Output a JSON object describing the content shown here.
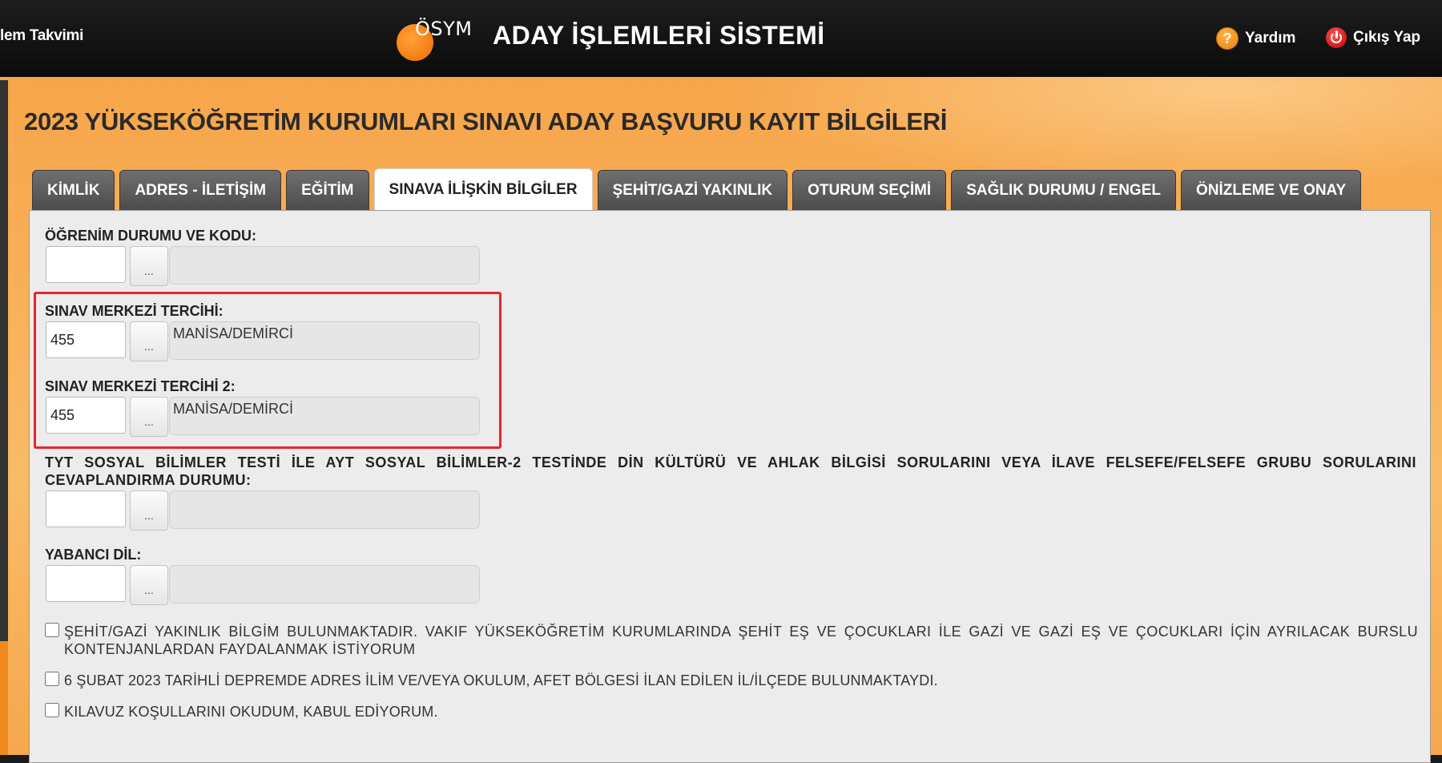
{
  "topbar": {
    "left_link": "lem Takvimi",
    "logo_text": "ÖSYM",
    "system_title": "ADAY İŞLEMLERİ SİSTEMİ",
    "help_label": "Yardım",
    "logout_label": "Çıkış Yap"
  },
  "page": {
    "title": "2023 YÜKSEKÖĞRETİM KURUMLARI SINAVI ADAY BAŞVURU KAYIT BİLGİLERİ"
  },
  "tabs": [
    {
      "label": "KİMLİK"
    },
    {
      "label": "ADRES - İLETİŞİM"
    },
    {
      "label": "EĞİTİM"
    },
    {
      "label": "SINAVA İLİŞKİN BİLGİLER",
      "active": true
    },
    {
      "label": "ŞEHİT/GAZİ YAKINLIK"
    },
    {
      "label": "OTURUM SEÇİMİ"
    },
    {
      "label": "SAĞLIK DURUMU / ENGEL"
    },
    {
      "label": "ÖNİZLEME VE ONAY"
    }
  ],
  "form": {
    "ogrenim": {
      "label": "ÖĞRENİM DURUMU VE KODU:",
      "code": "",
      "dots": "...",
      "desc": ""
    },
    "sinav_merkezi_1": {
      "label": "SINAV MERKEZİ TERCİHİ:",
      "code": "455",
      "dots": "...",
      "desc": "MANİSA/DEMİRCİ"
    },
    "sinav_merkezi_2": {
      "label": "SINAV MERKEZİ TERCİHİ 2:",
      "code": "455",
      "dots": "...",
      "desc": "MANİSA/DEMİRCİ"
    },
    "tyt_sosyal": {
      "label": "TYT SOSYAL BİLİMLER TESTİ İLE AYT SOSYAL BİLİMLER-2 TESTİNDE DİN KÜLTÜRÜ VE AHLAK BİLGİSİ SORULARINI VEYA İLAVE FELSEFE/FELSEFE GRUBU SORULARINI CEVAPLANDIRMA DURUMU:",
      "code": "",
      "dots": "...",
      "desc": ""
    },
    "yabanci_dil": {
      "label": "YABANCI DİL:",
      "code": "",
      "dots": "...",
      "desc": ""
    }
  },
  "checkboxes": [
    {
      "text": "ŞEHİT/GAZİ YAKINLIK BİLGİM BULUNMAKTADIR. VAKIF YÜKSEKÖĞRETİM KURUMLARINDA ŞEHİT EŞ VE ÇOCUKLARI İLE GAZİ VE GAZİ EŞ VE ÇOCUKLARI İÇİN AYRILACAK BURSLU KONTENJANLARDAN FAYDALANMAK İSTİYORUM",
      "checked": false
    },
    {
      "text": "6 ŞUBAT 2023 TARİHLİ DEPREMDE ADRES İLİM VE/VEYA OKULUM, AFET BÖLGESİ İLAN EDİLEN İL/İLÇEDE BULUNMAKTAYDI.",
      "checked": false
    },
    {
      "text": "KILAVUZ KOŞULLARINI OKUDUM, KABUL EDİYORUM.",
      "checked": false
    }
  ],
  "colors": {
    "topbar": "#111111",
    "orange": "#f7a54a",
    "highlight": "#e8262b",
    "tab_inactive": "#5a5a5a"
  }
}
